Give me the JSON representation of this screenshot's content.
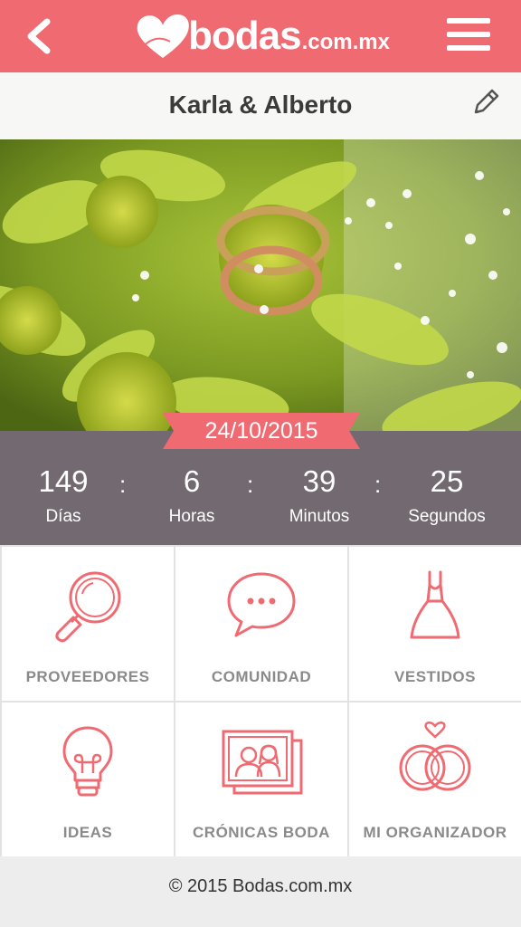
{
  "header": {
    "back_icon": "chevron-left-icon",
    "logo_text": "bodas",
    "logo_domain": ".com.mx",
    "menu_icon": "hamburger-menu-icon",
    "brand_color": "#f06a72"
  },
  "couple": {
    "names": "Karla & Alberto",
    "edit_icon": "pencil-icon"
  },
  "wedding_date": "24/10/2015",
  "countdown": {
    "days": {
      "value": "149",
      "label": "Días"
    },
    "hours": {
      "value": "6",
      "label": "Horas"
    },
    "minutes": {
      "value": "39",
      "label": "Minutos"
    },
    "seconds": {
      "value": "25",
      "label": "Segundos"
    },
    "separator": ":"
  },
  "menu_tiles": [
    {
      "label": "PROVEEDORES",
      "icon": "magnifier-icon"
    },
    {
      "label": "COMUNIDAD",
      "icon": "chat-bubble-icon"
    },
    {
      "label": "VESTIDOS",
      "icon": "dress-icon"
    },
    {
      "label": "IDEAS",
      "icon": "lightbulb-icon"
    },
    {
      "label": "CRÓNICAS BODA",
      "icon": "photo-couple-icon"
    },
    {
      "label": "MI ORGANIZADOR",
      "icon": "rings-heart-icon"
    }
  ],
  "footer": {
    "copyright": "© 2015 Bodas.com.mx"
  },
  "colors": {
    "accent": "#f06a72",
    "countdown_bg": "#726a70",
    "tile_label": "#8a8a8a"
  }
}
